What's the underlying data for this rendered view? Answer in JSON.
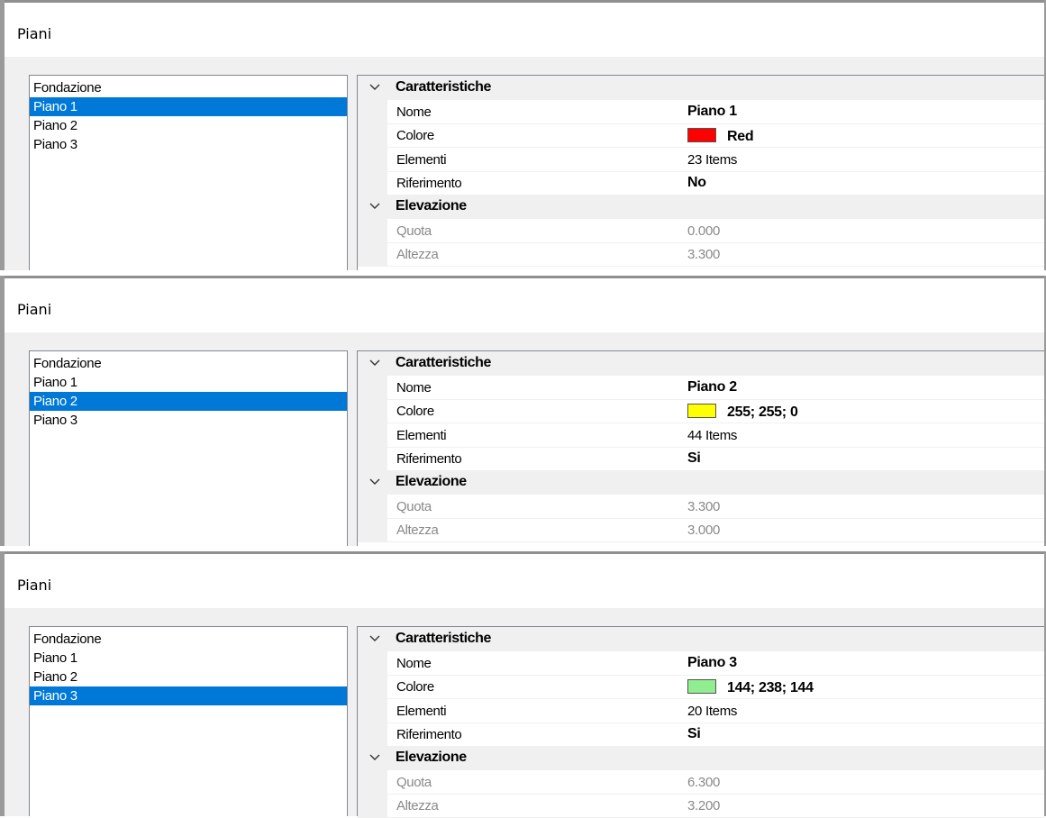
{
  "panels": [
    {
      "title": "Piani",
      "list": {
        "items": [
          "Fondazione",
          "Piano 1",
          "Piano 2",
          "Piano 3"
        ],
        "selected_index": 1
      },
      "grid": {
        "categories": [
          {
            "label": "Caratteristiche",
            "properties": [
              {
                "name": "Nome",
                "value": "Piano 1",
                "bold": true
              },
              {
                "name": "Colore",
                "value": "Red",
                "color": "#ff0000"
              },
              {
                "name": "Elementi",
                "value": "23 Items"
              },
              {
                "name": "Riferimento",
                "value": "No",
                "bold": true
              }
            ]
          },
          {
            "label": "Elevazione",
            "properties": [
              {
                "name": "Quota",
                "value": "0.000",
                "readonly": true
              },
              {
                "name": "Altezza",
                "value": "3.300",
                "readonly": true
              }
            ]
          }
        ]
      }
    },
    {
      "title": "Piani",
      "list": {
        "items": [
          "Fondazione",
          "Piano 1",
          "Piano 2",
          "Piano 3"
        ],
        "selected_index": 2
      },
      "grid": {
        "categories": [
          {
            "label": "Caratteristiche",
            "properties": [
              {
                "name": "Nome",
                "value": "Piano 2",
                "bold": true
              },
              {
                "name": "Colore",
                "value": "255; 255; 0",
                "color": "#ffff00"
              },
              {
                "name": "Elementi",
                "value": "44 Items"
              },
              {
                "name": "Riferimento",
                "value": "Si",
                "bold": true
              }
            ]
          },
          {
            "label": "Elevazione",
            "properties": [
              {
                "name": "Quota",
                "value": "3.300",
                "readonly": true
              },
              {
                "name": "Altezza",
                "value": "3.000",
                "readonly": true
              }
            ]
          }
        ]
      }
    },
    {
      "title": "Piani",
      "list": {
        "items": [
          "Fondazione",
          "Piano 1",
          "Piano 2",
          "Piano 3"
        ],
        "selected_index": 3
      },
      "grid": {
        "categories": [
          {
            "label": "Caratteristiche",
            "properties": [
              {
                "name": "Nome",
                "value": "Piano 3",
                "bold": true
              },
              {
                "name": "Colore",
                "value": "144; 238; 144",
                "color": "#90ee90"
              },
              {
                "name": "Elementi",
                "value": "20 Items"
              },
              {
                "name": "Riferimento",
                "value": "Si",
                "bold": true
              }
            ]
          },
          {
            "label": "Elevazione",
            "properties": [
              {
                "name": "Quota",
                "value": "6.300",
                "readonly": true
              },
              {
                "name": "Altezza",
                "value": "3.200",
                "readonly": true
              }
            ]
          }
        ]
      }
    }
  ],
  "colors": {
    "selection": "#0078d7",
    "category_bg": "#f0f0f0",
    "readonly_text": "#8a8a8a"
  }
}
